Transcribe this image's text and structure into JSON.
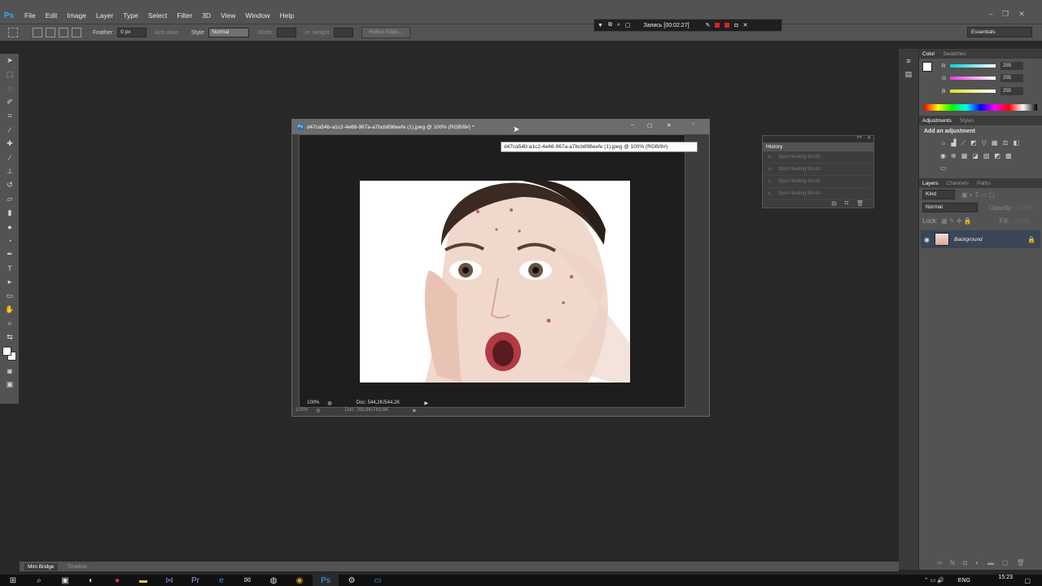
{
  "app": {
    "logo": "Ps"
  },
  "menu": [
    "File",
    "Edit",
    "Image",
    "Layer",
    "Type",
    "Select",
    "Filter",
    "3D",
    "View",
    "Window",
    "Help"
  ],
  "options_bar": {
    "feather_label": "Feather:",
    "feather_value": "0 px",
    "anti_alias_label": "Anti-alias",
    "style_label": "Style:",
    "style_value": "Normal",
    "width_label": "Width:",
    "height_label": "Height:",
    "refine_edge_label": "Refine Edge...",
    "workspace": "Essentials"
  },
  "recorder": {
    "label": "Запись [00:02:27]"
  },
  "document": {
    "title": "d47ca54b-a1c2-4e66-967a-a7bcb898eefe (1).jpeg @ 100% (RGB/8#) *",
    "tooltip": "d47ca54b-a1c2-4e66-967a-a7bcb898eefe (1).jpeg @ 100% (RGB/8#)",
    "zoom": "100%",
    "doc_info": "Doc: 544,2K/544,2K",
    "back_zoom": "100%",
    "back_doc_info": "Doc: 763,6K/763,6K"
  },
  "history": {
    "title": "History",
    "items": [
      "Spot Healing Brush",
      "Spot Healing Brush",
      "Spot Healing Brush",
      "Spot Healing Brush"
    ]
  },
  "color_panel": {
    "tabs": [
      "Color",
      "Swatches"
    ],
    "channels": [
      {
        "name": "R",
        "value": "255",
        "color": "#00d0d0"
      },
      {
        "name": "G",
        "value": "255",
        "color": "#e040e0"
      },
      {
        "name": "B",
        "value": "255",
        "color": "#e0e020"
      }
    ]
  },
  "adjustments": {
    "tabs": [
      "Adjustments",
      "Styles"
    ],
    "title": "Add an adjustment"
  },
  "layers": {
    "tabs": [
      "Layers",
      "Channels",
      "Paths"
    ],
    "kind": "Kind",
    "blend_mode": "Normal",
    "opacity_label": "Opacity:",
    "opacity_value": "100%",
    "lock_label": "Lock:",
    "fill_label": "Fill:",
    "fill_value": "100%",
    "layer_name": "Background"
  },
  "bottom_tabs": [
    "Mini Bridge",
    "Timeline"
  ],
  "taskbar": {
    "lang": "ENG",
    "time": "15:23"
  }
}
